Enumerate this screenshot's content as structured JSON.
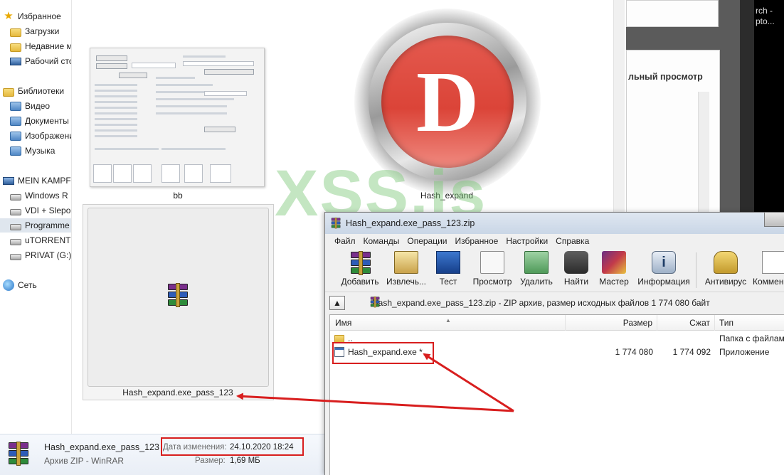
{
  "nav": {
    "favorites": "Избранное",
    "downloads": "Загрузки",
    "recent": "Недавние места",
    "desktop": "Рабочий стол",
    "libraries": "Библиотеки",
    "video": "Видео",
    "documents": "Документы",
    "images": "Изображения",
    "music": "Музыка",
    "computer": "MEIN KAMPF",
    "drive_win": "Windows R",
    "drive_vdi": "VDI + Slepok",
    "drive_prog": "Programme",
    "drive_torrent": "uTORRENT",
    "drive_privat": "PRIVAT (G:)",
    "network": "Сеть"
  },
  "files": {
    "bb_label": "bb",
    "hash_label": "Hash_expand",
    "selected_label": "Hash_expand.exe_pass_123",
    "logo_letter": "D"
  },
  "watermark": "XSS.is",
  "details": {
    "name": "Hash_expand.exe_pass_123",
    "kind": "Архив ZIP - WinRAR",
    "date_label": "Дата изменения:",
    "date_value": "24.10.2020 18:24",
    "size_label": "Размер:",
    "size_value": "1,69 МБ"
  },
  "behind": {
    "preview_title": "льный просмотр",
    "console_text": "rch -\npto..."
  },
  "winrar": {
    "title": "Hash_expand.exe_pass_123.zip",
    "menu": [
      "Файл",
      "Команды",
      "Операции",
      "Избранное",
      "Настройки",
      "Справка"
    ],
    "toolbar": {
      "add": "Добавить",
      "extract": "Извлечь...",
      "test": "Тест",
      "view": "Просмотр",
      "delete": "Удалить",
      "find": "Найти",
      "wizard": "Мастер",
      "info": "Информация",
      "antivirus": "Антивирус",
      "comment": "Коммен"
    },
    "path_text": "Hash_expand.exe_pass_123.zip - ZIP архив, размер исходных файлов 1 774 080 байт",
    "columns": {
      "name": "Имя",
      "size": "Размер",
      "packed": "Сжат",
      "type": "Тип"
    },
    "rows": [
      {
        "name": "..",
        "size": "",
        "packed": "",
        "type": "Папка с файлами"
      },
      {
        "name": "Hash_expand.exe *",
        "size": "1 774 080",
        "packed": "1 774 092",
        "type": "Приложение"
      }
    ]
  },
  "colors": {
    "annotation_red": "#d81e1e",
    "watermark_green": "#7dc878",
    "logo_red": "#db4438"
  }
}
